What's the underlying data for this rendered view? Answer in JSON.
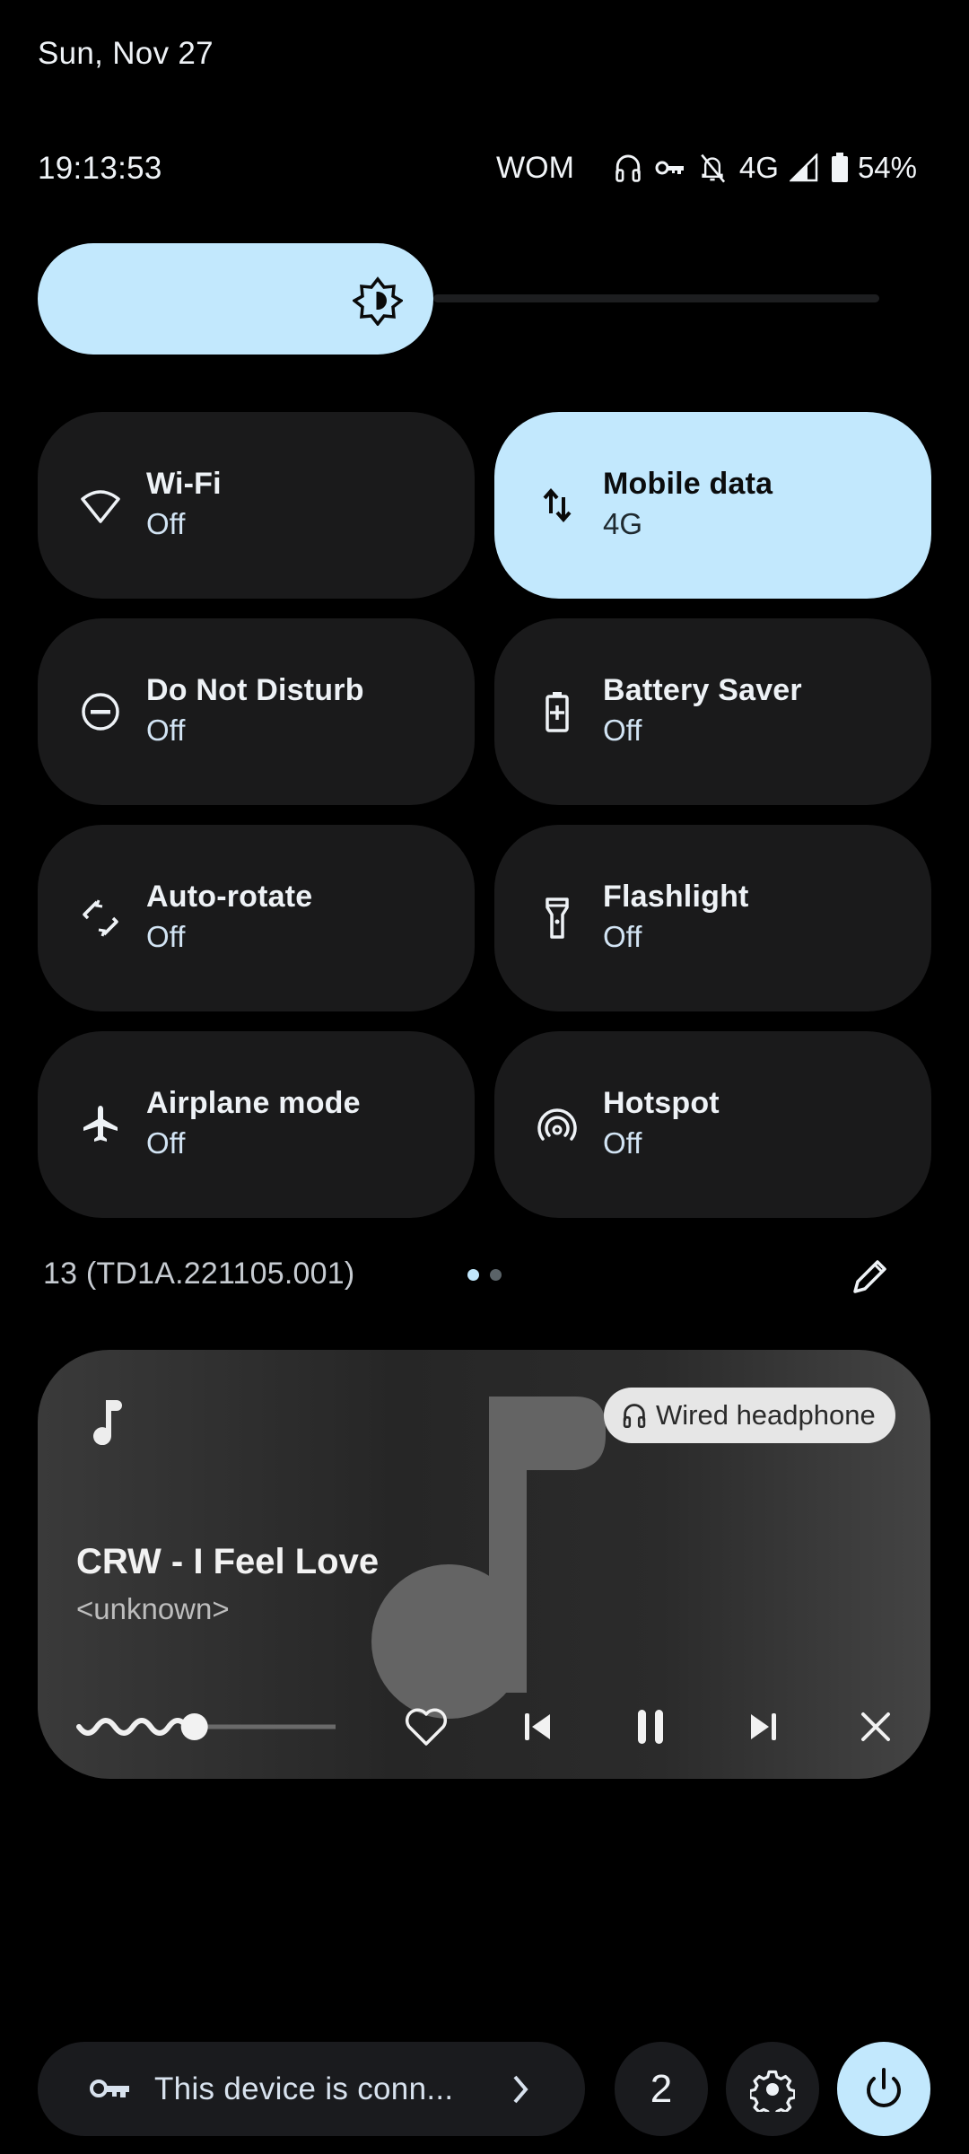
{
  "header": {
    "date": "Sun, Nov 27",
    "time": "19:13:53",
    "carrier": "WOM",
    "network_type": "4G",
    "battery_percent": "54%",
    "status_icons": [
      "headphones-icon",
      "vpn-key-icon",
      "notifications-off-icon",
      "signal-icon",
      "battery-icon"
    ]
  },
  "brightness": {
    "icon": "brightness-icon",
    "level": 0.47
  },
  "tiles": [
    {
      "label": "Wi-Fi",
      "state": "Off",
      "icon": "wifi-icon",
      "active": false
    },
    {
      "label": "Mobile data",
      "state": "4G",
      "icon": "mobile-data-icon",
      "active": true
    },
    {
      "label": "Do Not Disturb",
      "state": "Off",
      "icon": "do-not-disturb-icon",
      "active": false
    },
    {
      "label": "Battery Saver",
      "state": "Off",
      "icon": "battery-saver-icon",
      "active": false
    },
    {
      "label": "Auto-rotate",
      "state": "Off",
      "icon": "auto-rotate-icon",
      "active": false
    },
    {
      "label": "Flashlight",
      "state": "Off",
      "icon": "flashlight-icon",
      "active": false
    },
    {
      "label": "Airplane mode",
      "state": "Off",
      "icon": "airplane-icon",
      "active": false
    },
    {
      "label": "Hotspot",
      "state": "Off",
      "icon": "hotspot-icon",
      "active": false
    }
  ],
  "build_number": "13 (TD1A.221105.001)",
  "pager": {
    "pages": 2,
    "current": 1
  },
  "media": {
    "title": "CRW - I Feel Love",
    "artist": "<unknown>",
    "output_device": "Wired headphone",
    "progress": 0.45,
    "controls": [
      "like",
      "previous",
      "pause",
      "next",
      "dismiss"
    ]
  },
  "footer": {
    "security_text": "This device is conn...",
    "user_count": "2",
    "colors": {
      "accent": "#c2e8fd",
      "surface": "#1a1b1e"
    }
  }
}
